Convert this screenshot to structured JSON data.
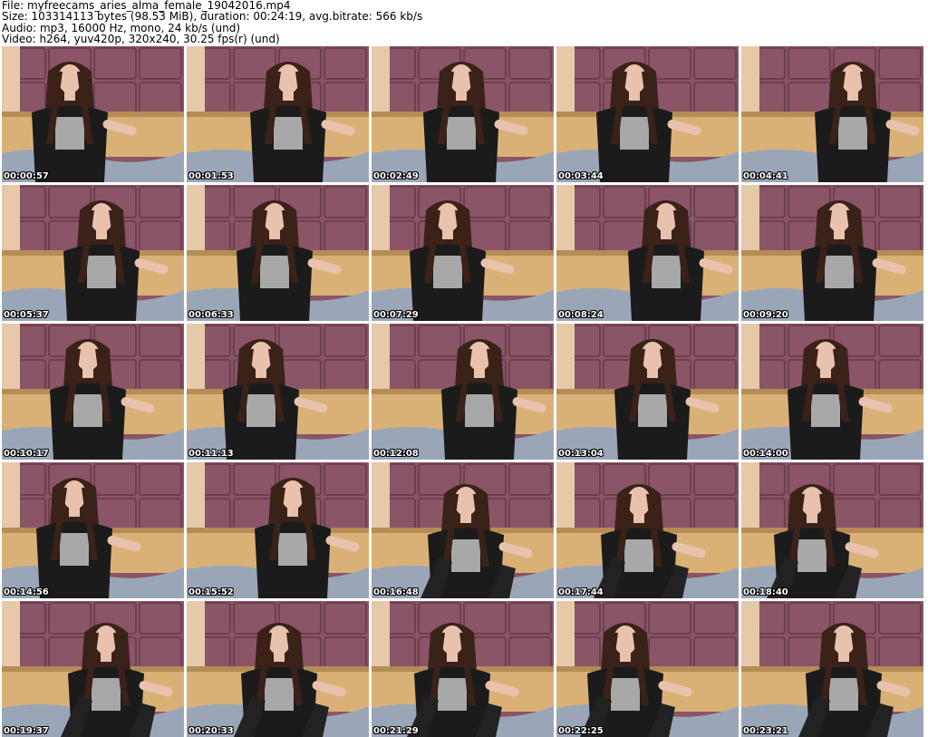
{
  "header": {
    "file": "File: myfreecams_aries_alma_female_19042016.mp4",
    "size": "Size: 103314113 bytes (98.53 MiB), duration: 00:24:19, avg.bitrate: 566 kb/s",
    "audio": "Audio: mp3, 16000 Hz, mono, 24 kb/s (und)",
    "video": "Video: h264, yuv420p, 320x240, 30.25 fps(r) (und)"
  },
  "colors": {
    "wall": "#8a5566",
    "wall_dark": "#6e3f50",
    "sofa": "#d9b177",
    "sofa_dark": "#b58c55",
    "blanket": "#9aa6b8",
    "hair": "#3a2219",
    "skin": "#e8c2ac",
    "shirt": "#1b1b1b"
  },
  "thumbnails": [
    {
      "time": "00:00:57"
    },
    {
      "time": "00:01:53"
    },
    {
      "time": "00:02:49"
    },
    {
      "time": "00:03:44"
    },
    {
      "time": "00:04:41"
    },
    {
      "time": "00:05:37"
    },
    {
      "time": "00:06:33"
    },
    {
      "time": "00:07:29"
    },
    {
      "time": "00:08:24"
    },
    {
      "time": "00:09:20"
    },
    {
      "time": "00:10:17"
    },
    {
      "time": "00:11:13"
    },
    {
      "time": "00:12:08"
    },
    {
      "time": "00:13:04"
    },
    {
      "time": "00:14:00"
    },
    {
      "time": "00:14:56"
    },
    {
      "time": "00:15:52"
    },
    {
      "time": "00:16:48"
    },
    {
      "time": "00:17:44"
    },
    {
      "time": "00:18:40"
    },
    {
      "time": "00:19:37"
    },
    {
      "time": "00:20:33"
    },
    {
      "time": "00:21:29"
    },
    {
      "time": "00:22:25"
    },
    {
      "time": "00:23:21"
    }
  ]
}
